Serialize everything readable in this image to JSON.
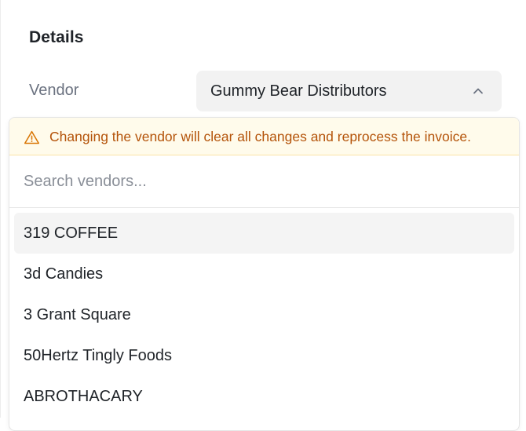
{
  "details": {
    "title": "Details",
    "vendor_label": "Vendor",
    "vendor_value": "Gummy Bear Distributors"
  },
  "dropdown": {
    "warning_text": "Changing the vendor will clear all changes and reprocess the invoice.",
    "search_placeholder": "Search vendors...",
    "search_value": "",
    "items": [
      {
        "label": "319 COFFEE",
        "highlighted": true
      },
      {
        "label": "3d Candies",
        "highlighted": false
      },
      {
        "label": "3 Grant Square",
        "highlighted": false
      },
      {
        "label": "50Hertz Tingly Foods",
        "highlighted": false
      },
      {
        "label": "ABROTHACARY",
        "highlighted": false
      }
    ]
  },
  "icons": {
    "select_chevron": "chevron-up-icon",
    "warning": "warning-triangle-icon"
  },
  "colors": {
    "warning_text": "#b45309",
    "warning_bg": "#fffbeb",
    "highlight_bg": "#f4f4f4",
    "select_bg": "#f2f2f2"
  }
}
